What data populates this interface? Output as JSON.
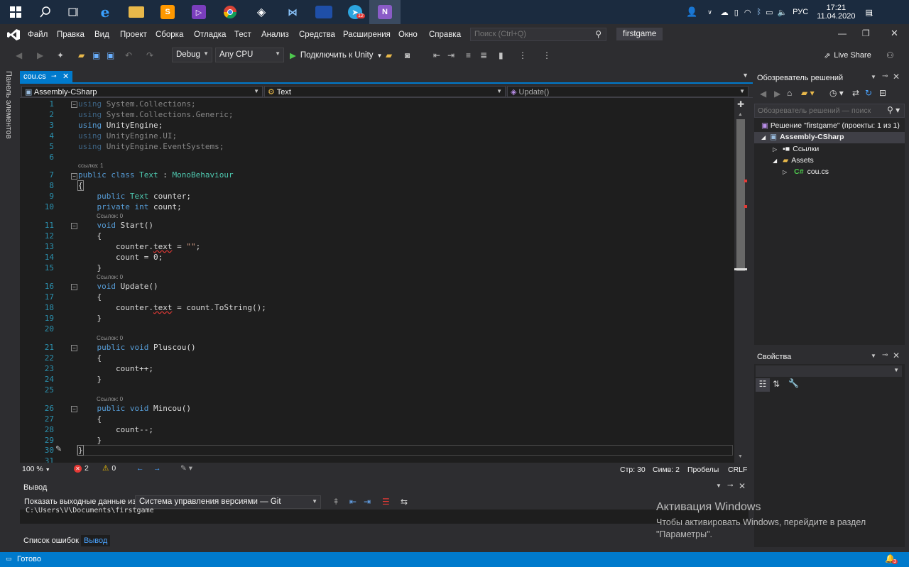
{
  "taskbar": {
    "icons": [
      "windows-logo",
      "search",
      "task-view",
      "edge",
      "file-explorer",
      "sublime",
      "visual-studio",
      "chrome",
      "unity",
      "visual-studio-code",
      "image-app",
      "telegram",
      "visual-studio-active"
    ],
    "telegram_badge": "12",
    "tray_lang": "РУС",
    "time": "17:21",
    "date": "11.04.2020",
    "notif_count": "1"
  },
  "menu": {
    "items": [
      "Файл",
      "Правка",
      "Вид",
      "Проект",
      "Сборка",
      "Отладка",
      "Тест",
      "Анализ",
      "Средства",
      "Расширения",
      "Окно",
      "Справка"
    ],
    "search_placeholder": "Поиск (Ctrl+Q)",
    "solution_name": "firstgame"
  },
  "toolbar": {
    "config": "Debug",
    "platform": "Any CPU",
    "run_label": "Подключить к Unity",
    "live_share": "Live Share"
  },
  "left_panel": {
    "label": "Панель элементов"
  },
  "editor": {
    "tab_name": "cou.cs",
    "nav_project": "Assembly-CSharp",
    "nav_class": "Text",
    "nav_member": "Update()",
    "zoom": "100 %",
    "errors": "2",
    "warnings": "0",
    "line_info": "Стр: 30",
    "col_info": "Симв: 2",
    "spaces": "Пробелы",
    "eol": "CRLF",
    "lens_ref1": "ссылка: 1",
    "lens_ref0": "Ссылок: 0",
    "line_numbers": [
      "1",
      "2",
      "3",
      "4",
      "5",
      "6",
      "7",
      "8",
      "9",
      "10",
      "11",
      "12",
      "13",
      "14",
      "15",
      "16",
      "17",
      "18",
      "19",
      "20",
      "21",
      "22",
      "23",
      "24",
      "25",
      "26",
      "27",
      "28",
      "29",
      "30",
      "31"
    ]
  },
  "output": {
    "title": "Вывод",
    "show_from_label": "Показать выходные данные из:",
    "source": "Система управления версиями — Git",
    "body": "C:\\Users\\V\\Documents\\firstgame"
  },
  "bottom_tabs": [
    "Список ошибок",
    "Вывод"
  ],
  "solution_explorer": {
    "title": "Обозреватель решений",
    "search_placeholder": "Обозреватель решений — поиск (Ct",
    "solution": "Решение \"firstgame\" (проекты: 1 из 1)",
    "project": "Assembly-CSharp",
    "refs": "Ссылки",
    "assets": "Assets",
    "file": "cou.cs"
  },
  "properties": {
    "title": "Свойства"
  },
  "watermark": {
    "line1": "Активация Windows",
    "line2": "Чтобы активировать Windows, перейдите в раздел",
    "line3": "\"Параметры\"."
  },
  "status": {
    "ready": "Готово",
    "notif": "3"
  },
  "colors": {
    "accent": "#007acc",
    "taskbar": "#1b2b3f",
    "editor_bg": "#1e1e1e",
    "keyword": "#569cd6",
    "type": "#4ec9b0"
  }
}
